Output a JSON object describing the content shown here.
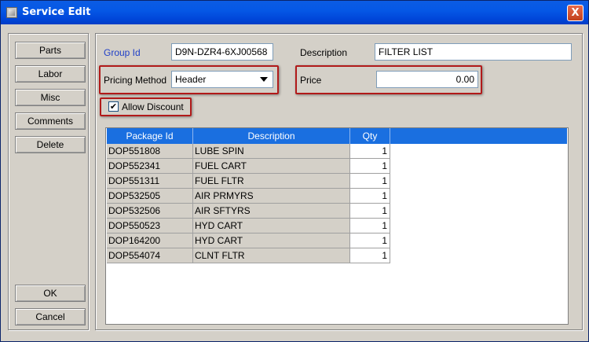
{
  "window": {
    "title": "Service Edit",
    "close_label": "X"
  },
  "side_buttons": {
    "parts": "Parts",
    "labor": "Labor",
    "misc": "Misc",
    "comments": "Comments",
    "delete": "Delete",
    "ok": "OK",
    "cancel": "Cancel"
  },
  "form": {
    "group_id_label": "Group Id",
    "group_id_value": "D9N-DZR4-6XJ00568",
    "description_label": "Description",
    "description_value": "FILTER LIST",
    "pricing_method_label": "Pricing Method",
    "pricing_method_value": "Header",
    "price_label": "Price",
    "price_value": "0.00",
    "allow_discount_label": "Allow Discount",
    "allow_discount_checked": true,
    "check_glyph": "✔"
  },
  "table": {
    "columns": [
      "Package Id",
      "Description",
      "Qty"
    ],
    "rows": [
      {
        "package_id": "DOP551808",
        "description": "LUBE SPIN",
        "qty": "1"
      },
      {
        "package_id": "DOP552341",
        "description": "FUEL CART",
        "qty": "1"
      },
      {
        "package_id": "DOP551311",
        "description": "FUEL FLTR",
        "qty": "1"
      },
      {
        "package_id": "DOP532505",
        "description": "AIR PRMYRS",
        "qty": "1"
      },
      {
        "package_id": "DOP532506",
        "description": "AIR SFTYRS",
        "qty": "1"
      },
      {
        "package_id": "DOP550523",
        "description": "HYD CART",
        "qty": "1"
      },
      {
        "package_id": "DOP164200",
        "description": "HYD CART",
        "qty": "1"
      },
      {
        "package_id": "DOP554074",
        "description": "CLNT FLTR",
        "qty": "1"
      }
    ]
  },
  "colors": {
    "title_bar": "#0558e6",
    "table_header": "#1a6fe0",
    "highlight_box": "#b11a1a",
    "link_label": "#1f3fc7"
  }
}
